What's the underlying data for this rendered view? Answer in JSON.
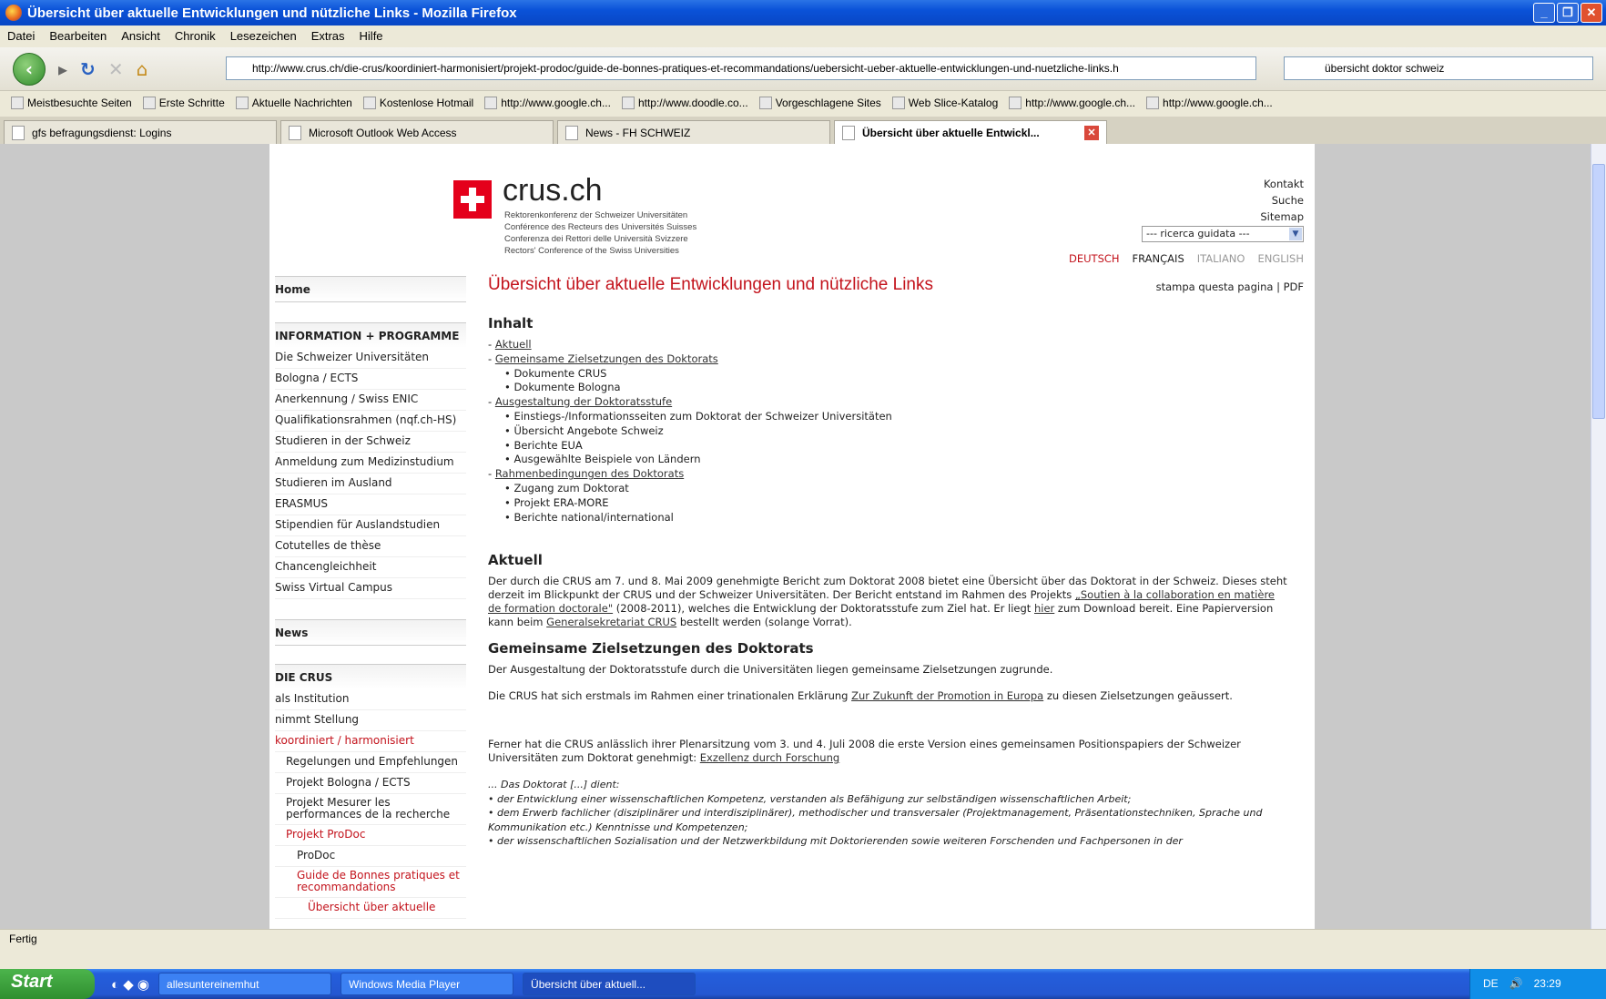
{
  "window": {
    "title": "Übersicht über aktuelle Entwicklungen und nützliche Links - Mozilla Firefox"
  },
  "menu": [
    "Datei",
    "Bearbeiten",
    "Ansicht",
    "Chronik",
    "Lesezeichen",
    "Extras",
    "Hilfe"
  ],
  "address": {
    "url": "http://www.crus.ch/die-crus/koordiniert-harmonisiert/projekt-prodoc/guide-de-bonnes-pratiques-et-recommandations/uebersicht-ueber-aktuelle-entwicklungen-und-nuetzliche-links.h",
    "search_value": "übersicht doktor schweiz"
  },
  "bookmarks": [
    "Meistbesuchte Seiten",
    "Erste Schritte",
    "Aktuelle Nachrichten",
    "Kostenlose Hotmail",
    "http://www.google.ch...",
    "http://www.doodle.co...",
    "Vorgeschlagene Sites",
    "Web Slice-Katalog",
    "http://www.google.ch...",
    "http://www.google.ch..."
  ],
  "tabs": [
    "gfs befragungsdienst: Logins",
    "Microsoft Outlook Web Access",
    "News - FH SCHWEIZ",
    "Übersicht über aktuelle Entwickl..."
  ],
  "site": {
    "name": "crus.ch",
    "sub": [
      "Rektorenkonferenz der Schweizer Universitäten",
      "Conférence des Recteurs des Universités Suisses",
      "Conferenza dei Rettori delle Università Svizzere",
      "Rectors' Conference of the Swiss Universities"
    ],
    "topnav": [
      "Kontakt",
      "Suche",
      "Sitemap"
    ],
    "ricerca": "--- ricerca guidata ---",
    "langs": [
      "DEUTSCH",
      "FRANÇAIS",
      "ITALIANO",
      "ENGLISH"
    ],
    "page_title": "Übersicht über aktuelle Entwicklungen und nützliche Links",
    "print": "stampa questa pagina",
    "pdf": "PDF"
  },
  "sidebar": {
    "home": "Home",
    "info_header": "INFORMATION + PROGRAMME",
    "info_items": [
      "Die Schweizer Universitäten",
      "Bologna / ECTS",
      "Anerkennung / Swiss ENIC",
      "Qualifikationsrahmen (nqf.ch-HS)",
      "Studieren in der Schweiz",
      "Anmeldung zum Medizinstudium",
      "Studieren im Ausland",
      "ERASMUS",
      "Stipendien für Auslandstudien",
      "Cotutelles de thèse",
      "Chancengleichheit",
      "Swiss Virtual Campus"
    ],
    "news": "News",
    "crus_header": "DIE CRUS",
    "crus_items": [
      "als Institution",
      "nimmt Stellung",
      "koordiniert / harmonisiert"
    ],
    "sub_items": [
      "Regelungen und Empfehlungen",
      "Projekt Bologna / ECTS",
      "Projekt Mesurer les performances de la recherche",
      "Projekt ProDoc"
    ],
    "sub2_items": [
      "ProDoc",
      "Guide de Bonnes pratiques et recommandations",
      "Übersicht über aktuelle"
    ]
  },
  "content": {
    "inhalt": "Inhalt",
    "toc": [
      "Aktuell",
      "Gemeinsame Zielsetzungen des Doktorats",
      "Ausgestaltung der Doktoratsstufe",
      "Rahmenbedingungen des Doktorats"
    ],
    "toc_sub1": [
      "Dokumente CRUS",
      "Dokumente Bologna"
    ],
    "toc_sub2": [
      "Einstiegs-/Informationsseiten zum Doktorat der Schweizer Universitäten",
      "Übersicht Angebote Schweiz",
      "Berichte EUA",
      "Ausgewählte Beispiele von Ländern"
    ],
    "toc_sub3": [
      "Zugang zum Doktorat",
      "Projekt ERA-MORE",
      "Berichte national/international"
    ],
    "aktuell_h": "Aktuell",
    "aktuell_p1": "Der durch die CRUS am 7. und 8. Mai 2009 genehmigte Bericht zum Doktorat 2008 bietet eine Übersicht über das Doktorat in der Schweiz. Dieses steht derzeit im Blickpunkt der CRUS und der Schweizer Universitäten. Der Bericht entstand im Rahmen des Projekts ",
    "aktuell_link1": "„Soutien à la collaboration en matière de formation doctorale\"",
    "aktuell_p2": " (2008-2011), welches die Entwicklung der Doktoratsstufe zum Ziel hat. Er liegt ",
    "aktuell_link2": "hier",
    "aktuell_p3": " zum Download bereit. Eine Papierversion kann beim ",
    "aktuell_link3": "Generalsekretariat CRUS",
    "aktuell_p4": " bestellt werden (solange Vorrat).",
    "ziel_h": "Gemeinsame Zielsetzungen des Doktorats",
    "ziel_p1": "Der Ausgestaltung der Doktoratsstufe durch die Universitäten liegen gemeinsame Zielsetzungen zugrunde.",
    "ziel_p2a": "Die CRUS hat sich erstmals im Rahmen einer trinationalen Erklärung ",
    "ziel_link1": "Zur Zukunft der Promotion in Europa",
    "ziel_p2b": " zu diesen Zielsetzungen geäussert.",
    "ziel_p3a": "Ferner hat die CRUS anlässlich ihrer Plenarsitzung vom 3. und 4. Juli 2008 die erste Version eines gemeinsamen Positionspapiers der Schweizer Universitäten zum Doktorat genehmigt: ",
    "ziel_link2": "Exzellenz durch Forschung",
    "quote": [
      "... Das Doktorat [...] dient:",
      "• der Entwicklung einer wissenschaftlichen Kompetenz, verstanden als Befähigung zur selbständigen wissenschaftlichen Arbeit;",
      "• dem Erwerb fachlicher (disziplinärer und interdisziplinärer), methodischer und transversaler (Projektmanagement, Präsentationstechniken, Sprache und Kommunikation etc.) Kenntnisse und Kompetenzen;",
      "• der wissenschaftlichen Sozialisation und der Netzwerkbildung mit Doktorierenden sowie weiteren Forschenden und Fachpersonen in der"
    ]
  },
  "status": "Fertig",
  "taskbar": {
    "start": "Start",
    "tasks": [
      "allesuntereinemhut",
      "Windows Media Player",
      "Übersicht über aktuell..."
    ],
    "lang": "DE",
    "clock": "23:29"
  }
}
